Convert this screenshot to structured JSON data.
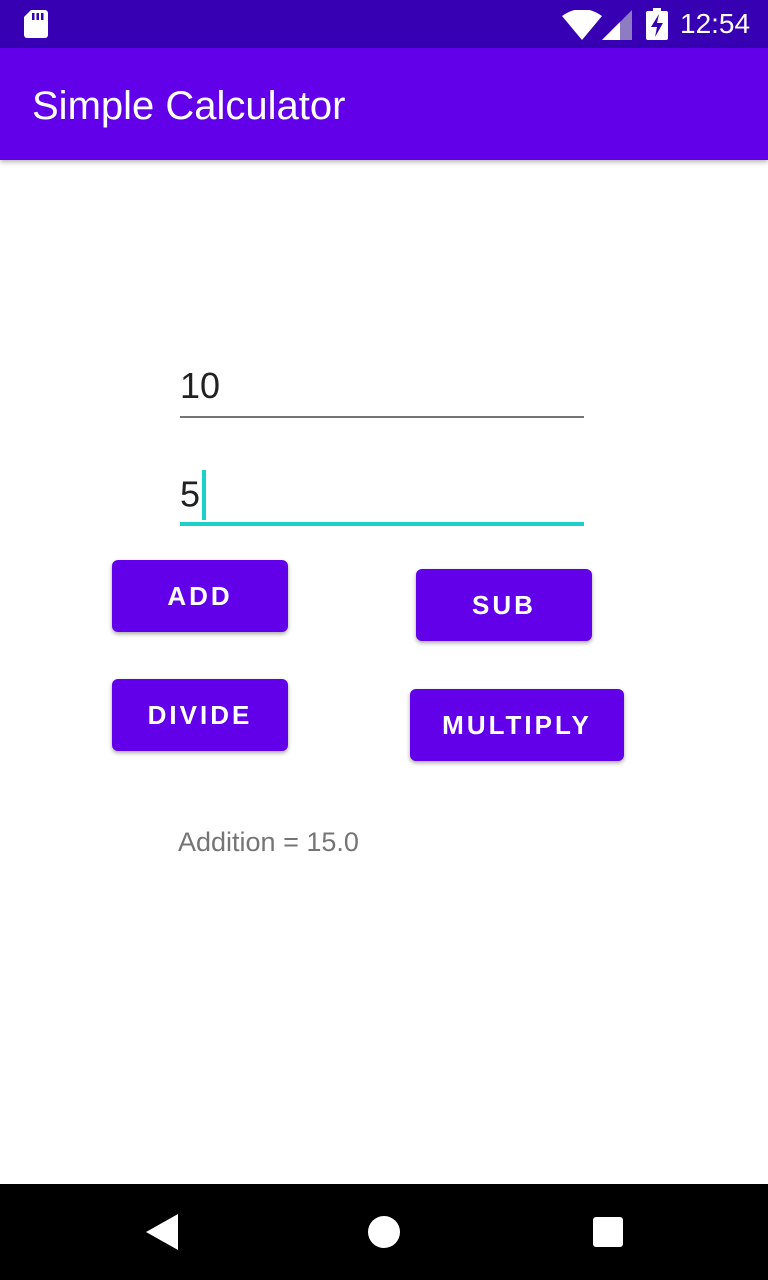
{
  "status_bar": {
    "time": "12:54",
    "icons": [
      "sd-card-icon",
      "wifi-icon",
      "signal-icon",
      "battery-charging-icon"
    ]
  },
  "app_bar": {
    "title": "Simple Calculator"
  },
  "inputs": {
    "first_number": "10",
    "second_number": "5"
  },
  "buttons": {
    "add": "ADD",
    "sub": "SUB",
    "divide": "DIVIDE",
    "multiply": "MULTIPLY"
  },
  "result": {
    "text": "Addition = 15.0"
  },
  "nav_bar": {
    "icons": [
      "back-icon",
      "home-icon",
      "recents-icon"
    ]
  },
  "colors": {
    "status_bar": "#3700b3",
    "primary": "#6200ea",
    "accent": "#1ccfc9",
    "result_text": "#757575"
  }
}
